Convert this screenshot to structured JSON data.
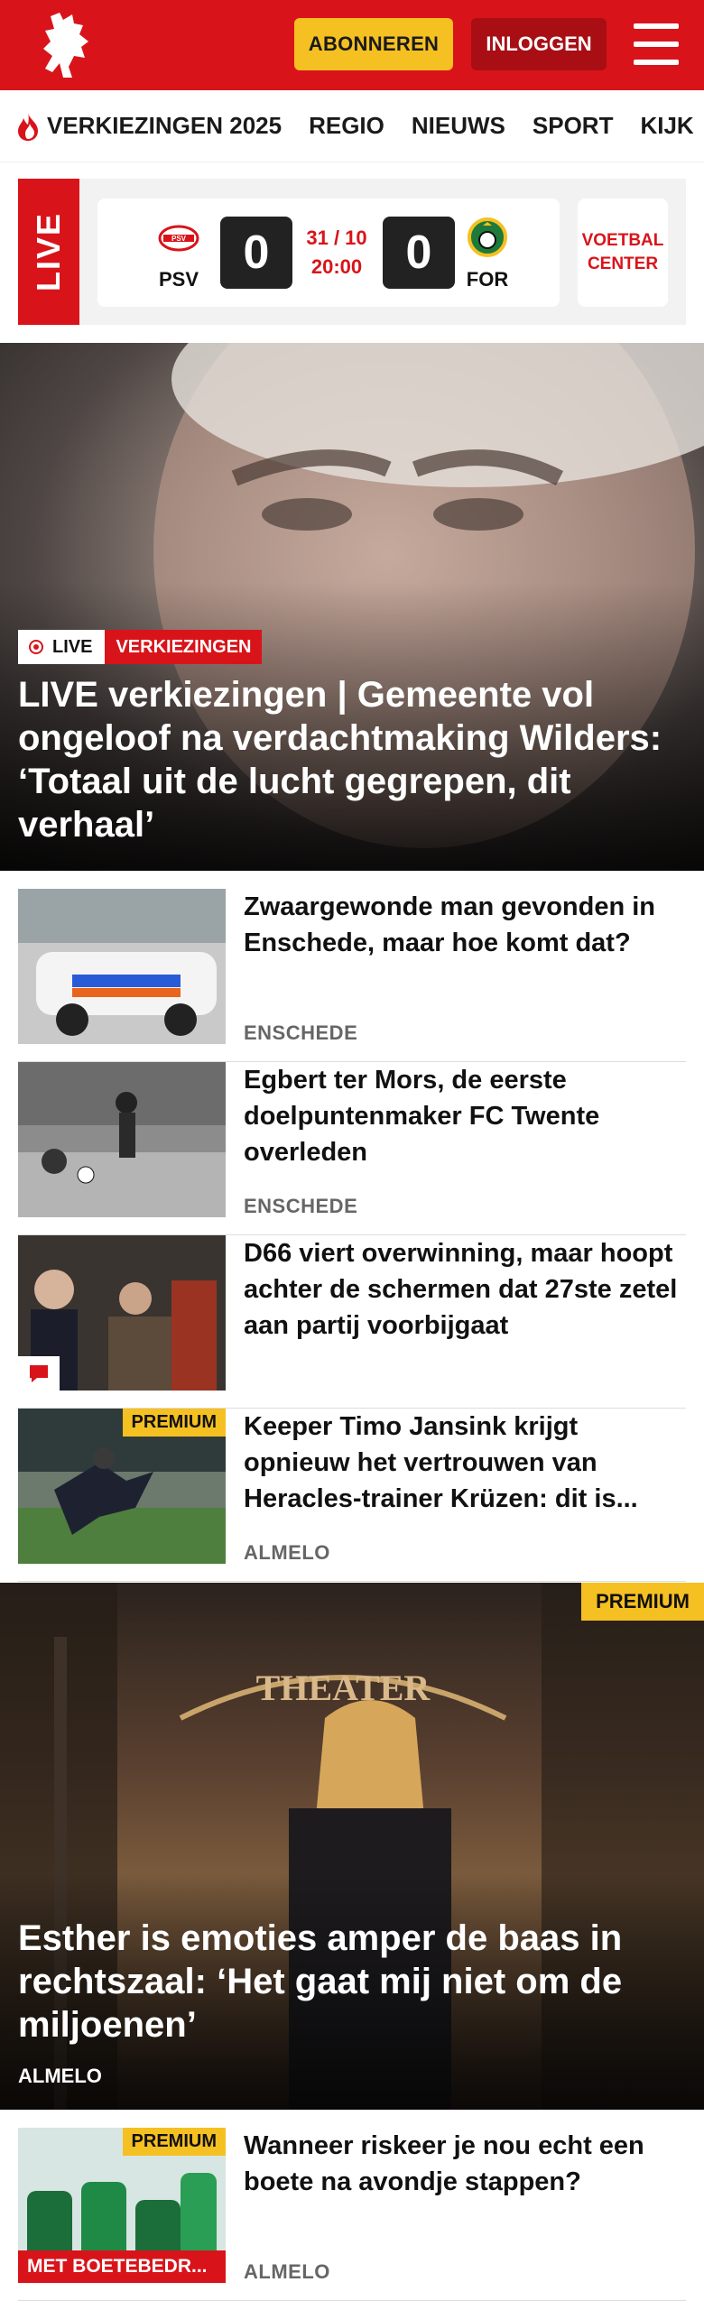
{
  "header": {
    "subscribe_label": "ABONNEREN",
    "login_label": "INLOGGEN"
  },
  "nav": {
    "items": [
      "VERKIEZINGEN 2025",
      "REGIO",
      "NIEUWS",
      "SPORT",
      "KIJK"
    ]
  },
  "live_match": {
    "live_label": "LIVE",
    "home_team": "PSV",
    "away_team": "FOR",
    "home_score": "0",
    "away_score": "0",
    "date": "31 / 10",
    "time": "20:00",
    "voetbal_center_label": "VOETBAL CENTER"
  },
  "hero": {
    "live_badge": "LIVE",
    "category_badge": "VERKIEZINGEN",
    "title": "LIVE verkiezingen | Gemeente vol ongeloof na verdachtmaking Wilders: ‘Totaal uit de lucht gegrepen, dit verhaal’"
  },
  "articles": [
    {
      "title": "Zwaargewonde man gevonden in Enschede, maar hoe komt dat?",
      "location": "ENSCHEDE"
    },
    {
      "title": "Egbert ter Mors, de eerste doelpuntenmaker FC Twente overleden",
      "location": "ENSCHEDE"
    },
    {
      "title": "D66 viert overwinning, maar hoopt achter de schermen dat 27ste zetel aan partij voorbijgaat",
      "location": ""
    },
    {
      "title": "Keeper Timo Jansink krijgt opnieuw het vertrouwen van Heracles-trainer Krüzen: dit is...",
      "location": "ALMELO",
      "premium": "PREMIUM"
    }
  ],
  "feature": {
    "premium": "PREMIUM",
    "title": "Esther is emoties amper de baas in rechtszaal: ‘Het gaat mij niet om de miljoenen’",
    "location": "ALMELO"
  },
  "articles2": [
    {
      "title": "Wanneer riskeer je nou echt een boete na avondje stappen?",
      "location": "ALMELO",
      "premium": "PREMIUM",
      "tag": "MET BOETEBEDR..."
    }
  ]
}
